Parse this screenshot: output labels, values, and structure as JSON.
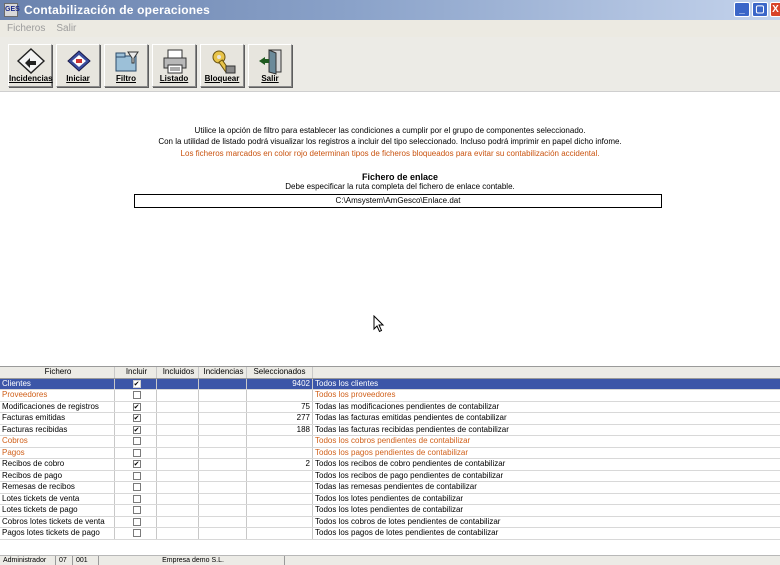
{
  "window": {
    "title": "Contabilización de operaciones",
    "app_icon_text": "GES"
  },
  "window_controls": {
    "minimize": "_",
    "maximize": "▢",
    "close": "X"
  },
  "menu": {
    "items": [
      {
        "label": "Ficheros"
      },
      {
        "label": "Salir"
      }
    ]
  },
  "toolbar": {
    "buttons": [
      {
        "label": "Incidencias",
        "icon": "diamond-arrows-icon"
      },
      {
        "label": "Iniciar",
        "icon": "book-start-icon"
      },
      {
        "label": "Filtro",
        "icon": "folder-filter-icon"
      },
      {
        "label": "Listado",
        "icon": "printer-list-icon"
      },
      {
        "label": "Bloquear",
        "icon": "key-lock-icon"
      },
      {
        "label": "Salir",
        "icon": "exit-door-icon"
      }
    ]
  },
  "info": {
    "line1": "Utilice la opción de filtro para establecer las condiciones a cumplir por el grupo de componentes seleccionado.",
    "line2": "Con la utilidad de listado podrá visualizar los registros a incluir del tipo seleccionado. Incluso podrá imprimir en papel dicho infome.",
    "line3": "Los ficheros marcados en color rojo determinan tipos de ficheros bloqueados para evitar su contabilización accidental."
  },
  "link_file": {
    "title": "Fichero de enlace",
    "subtitle": "Debe especificar la ruta completa del fichero de enlace contable.",
    "path": "C:\\Amsystem\\AmGesco\\Enlace.dat"
  },
  "grid": {
    "columns": [
      "Fichero",
      "Incluir",
      "Incluidos",
      "Incidencias",
      "Seleccionados",
      ""
    ],
    "rows": [
      {
        "fichero": "Clientes",
        "incluir": true,
        "incluidos": "",
        "incidencias": "",
        "seleccionados": "9402",
        "descripcion": "Todos los clientes",
        "state": "selected"
      },
      {
        "fichero": "Proveedores",
        "incluir": false,
        "incluidos": "",
        "incidencias": "",
        "seleccionados": "",
        "descripcion": "Todos los proveedores",
        "state": "blocked"
      },
      {
        "fichero": "Modificaciones de registros",
        "incluir": true,
        "incluidos": "",
        "incidencias": "",
        "seleccionados": "75",
        "descripcion": "Todas las modificaciones pendientes de contabilizar",
        "state": "normal"
      },
      {
        "fichero": "Facturas emitidas",
        "incluir": true,
        "incluidos": "",
        "incidencias": "",
        "seleccionados": "277",
        "descripcion": "Todas las facturas emitidas pendientes de contabilizar",
        "state": "normal"
      },
      {
        "fichero": "Facturas recibidas",
        "incluir": true,
        "incluidos": "",
        "incidencias": "",
        "seleccionados": "188",
        "descripcion": "Todas las facturas recibidas pendientes de contabilizar",
        "state": "normal"
      },
      {
        "fichero": "Cobros",
        "incluir": false,
        "incluidos": "",
        "incidencias": "",
        "seleccionados": "",
        "descripcion": "Todos los cobros pendientes de contabilizar",
        "state": "blocked"
      },
      {
        "fichero": "Pagos",
        "incluir": false,
        "incluidos": "",
        "incidencias": "",
        "seleccionados": "",
        "descripcion": "Todos los pagos pendientes de contabilizar",
        "state": "blocked"
      },
      {
        "fichero": "Recibos de cobro",
        "incluir": true,
        "incluidos": "",
        "incidencias": "",
        "seleccionados": "2",
        "descripcion": "Todos los recibos de cobro pendientes de contabilizar",
        "state": "normal"
      },
      {
        "fichero": "Recibos de pago",
        "incluir": false,
        "incluidos": "",
        "incidencias": "",
        "seleccionados": "",
        "descripcion": "Todos los recibos de pago pendientes de contabilizar",
        "state": "normal"
      },
      {
        "fichero": "Remesas de recibos",
        "incluir": false,
        "incluidos": "",
        "incidencias": "",
        "seleccionados": "",
        "descripcion": "Todas las remesas pendientes de contabilizar",
        "state": "normal"
      },
      {
        "fichero": "Lotes tickets de venta",
        "incluir": false,
        "incluidos": "",
        "incidencias": "",
        "seleccionados": "",
        "descripcion": "Todos los lotes pendientes de contabilizar",
        "state": "normal"
      },
      {
        "fichero": "Lotes tickets de pago",
        "incluir": false,
        "incluidos": "",
        "incidencias": "",
        "seleccionados": "",
        "descripcion": "Todos los lotes pendientes de contabilizar",
        "state": "normal"
      },
      {
        "fichero": "Cobros lotes tickets de venta",
        "incluir": false,
        "incluidos": "",
        "incidencias": "",
        "seleccionados": "",
        "descripcion": "Todos los cobros de lotes pendientes de contabilizar",
        "state": "normal"
      },
      {
        "fichero": "Pagos lotes tickets de pago",
        "incluir": false,
        "incluidos": "",
        "incidencias": "",
        "seleccionados": "",
        "descripcion": "Todos los pagos de lotes pendientes de contabilizar",
        "state": "normal"
      }
    ]
  },
  "status_bar": {
    "user": "Administrador",
    "field1": "07",
    "field2": "001",
    "company": "Empresa demo S.L.",
    "extra": ""
  },
  "colors": {
    "selected_row": "#3c56a8",
    "blocked_text": "#d0601a",
    "titlebar": "#6a82ad"
  }
}
